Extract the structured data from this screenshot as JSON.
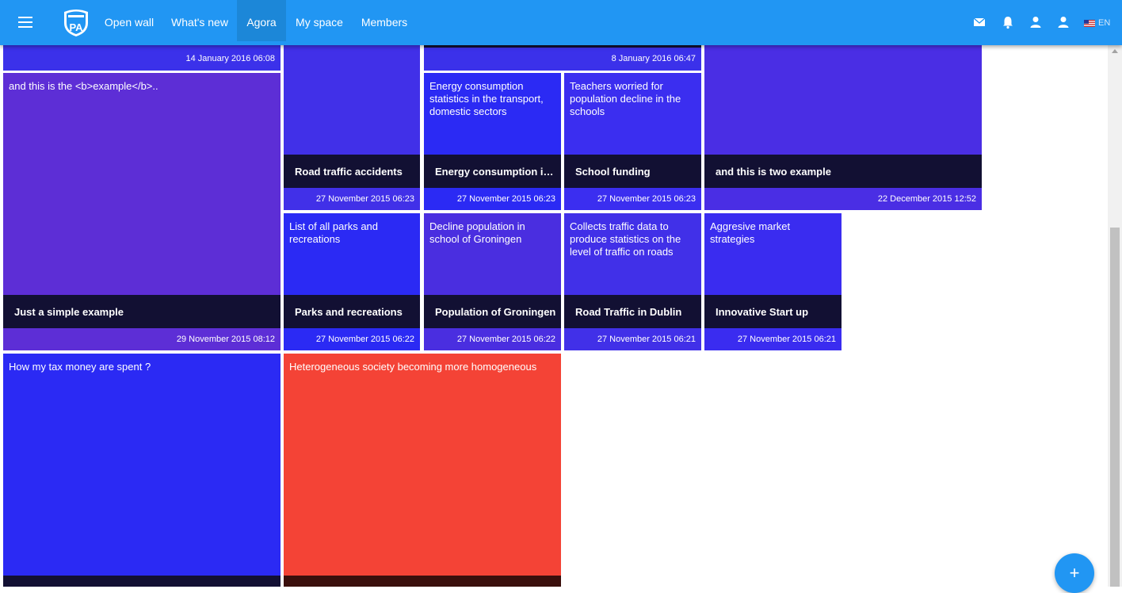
{
  "nav": {
    "items": [
      "Open wall",
      "What's new",
      "Agora",
      "My space",
      "Members"
    ],
    "active": "Agora",
    "lang_label": "EN"
  },
  "colors": {
    "topbar": "#2196f3",
    "tile_purple": "#5d2ed6",
    "tile_blue": "#2b2af4",
    "tile_indigo": "#4130e8",
    "tile_red": "#f44336",
    "title_bar": "#121033",
    "fab": "#2196f3"
  },
  "icons": [
    "menu-icon",
    "mail-icon",
    "bell-icon",
    "user-icon",
    "profile-icon",
    "us-flag-icon",
    "plus-icon"
  ],
  "tiles": {
    "t_top_left": {
      "date": "14 January 2016 06:08"
    },
    "t_top_wide": {
      "date": "8 January 2016 06:47"
    },
    "t_example": {
      "desc": "and this is the <b>example</b>..",
      "title": "Just a simple example",
      "date": "29 November 2015 08:12"
    },
    "t_road_accidents": {
      "title": "Road traffic accidents",
      "date": "27 November 2015 06:23"
    },
    "t_energy": {
      "desc": "Energy consumption statistics in the transport, domestic sectors",
      "title": "Energy consumption in I...",
      "date": "27 November 2015 06:23"
    },
    "t_school": {
      "desc": "Teachers worried for population decline in the schools",
      "title": "School funding",
      "date": "27 November 2015 06:23"
    },
    "t_two_example": {
      "title": "and this is two example",
      "date": "22 December 2015 12:52"
    },
    "t_parks": {
      "desc": "List of all parks and recreations",
      "title": "Parks and recreations",
      "date": "27 November 2015 06:22"
    },
    "t_groningen": {
      "desc": "Decline population in school of Groningen",
      "title": "Population of Groningen",
      "date": "27 November 2015 06:22"
    },
    "t_dublin": {
      "desc": "Collects traffic data to produce statistics on the level of traffic on roads",
      "title": "Road Traffic in Dublin",
      "date": "27 November 2015 06:21"
    },
    "t_startup": {
      "desc": "Aggresive market strategies",
      "title": "Innovative Start up",
      "date": "27 November 2015 06:21"
    },
    "t_tax": {
      "desc": "How my tax money are spent ?"
    },
    "t_society": {
      "desc": "Heterogeneous society becoming more homogeneous"
    }
  }
}
